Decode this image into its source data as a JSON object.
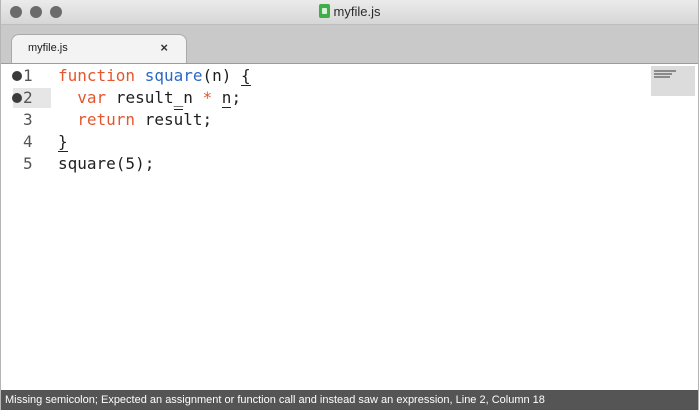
{
  "window": {
    "title": "myfile.js",
    "file_icon": "js-file-icon",
    "traffic_lights": [
      "close",
      "minimize",
      "zoom"
    ]
  },
  "tabs": [
    {
      "label": "myfile.js",
      "close_label": "×",
      "active": true
    }
  ],
  "editor": {
    "active_line": 2,
    "lines": [
      {
        "number": "1",
        "has_marker": true
      },
      {
        "number": "2",
        "has_marker": true
      },
      {
        "number": "3",
        "has_marker": false
      },
      {
        "number": "4",
        "has_marker": false
      },
      {
        "number": "5",
        "has_marker": false
      }
    ],
    "code": {
      "l1_kw": "function",
      "l1_fn": "square",
      "l1_rest": "(n) ",
      "l1_brace": "{",
      "l2_kw": "var",
      "l2_a": " result",
      "l2_b": "_n ",
      "l2_op": "*",
      "l2_c": " ",
      "l2_n": "n",
      "l2_semi": ";",
      "l3_kw": "return",
      "l3_a": " res",
      "l3_b": "u",
      "l3_c": "lt;",
      "l4_brace": "}",
      "l5_text": "square(5);"
    },
    "colors": {
      "keyword": "#e4572e",
      "function_name": "#2a68c8",
      "text": "#1f1f1f"
    }
  },
  "statusbar": {
    "message": "Missing semicolon; Expected an assignment or function call and instead saw an expression, Line 2, Column 18"
  }
}
